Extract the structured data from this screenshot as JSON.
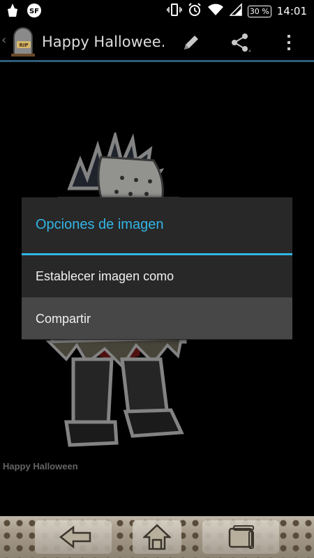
{
  "status_bar": {
    "battery": "30 %",
    "time": "14:01",
    "icons": [
      "cleaner-icon",
      "sf-badge-icon",
      "vibrate-icon",
      "alarm-icon",
      "wifi-icon",
      "signal-icon",
      "battery-icon"
    ]
  },
  "action_bar": {
    "title": "Happy Hallowee…",
    "icons": [
      "rip-tombstone-logo-icon",
      "edit-pencil-icon",
      "share-icon",
      "overflow-menu-icon"
    ]
  },
  "content": {
    "caption": "Happy Halloween"
  },
  "dialog": {
    "title": "Opciones de imagen",
    "items": [
      {
        "label": "Establecer imagen como"
      },
      {
        "label": "Compartir"
      }
    ],
    "accent_color": "#33b5e5"
  },
  "nav_bar": {
    "icons": [
      "back-arrow-icon",
      "home-icon",
      "recent-apps-icon"
    ]
  }
}
